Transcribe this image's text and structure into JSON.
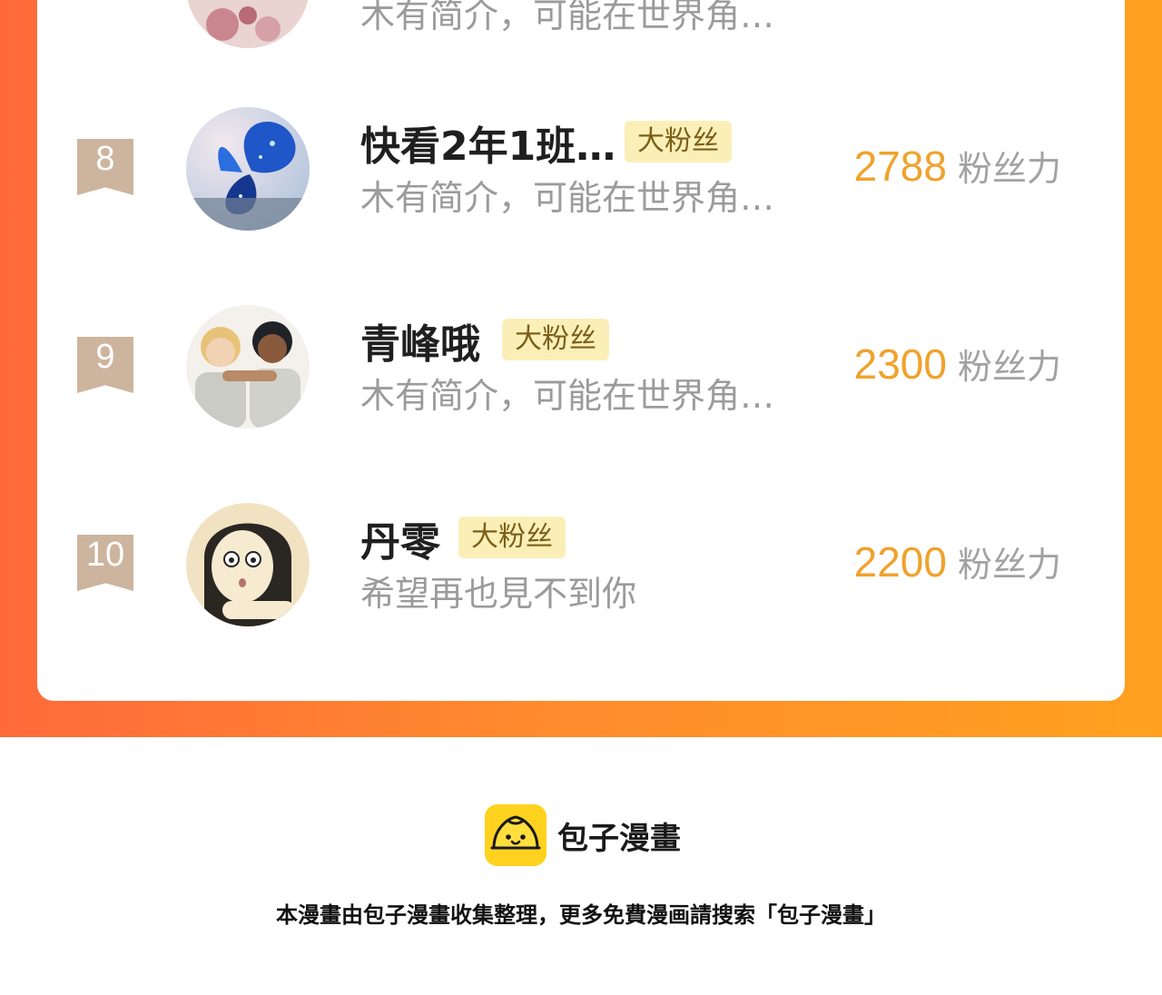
{
  "ranking": {
    "rows": [
      {
        "rank": "",
        "avatar": "flower-avatar",
        "name": "",
        "badge": "",
        "description": "木有简介，可能在世界角…",
        "score": "",
        "unit": ""
      },
      {
        "rank": "8",
        "avatar": "butterfly-avatar",
        "name": "快看2年1班…",
        "badge": "大粉丝",
        "description": "木有简介，可能在世界角…",
        "score": "2788",
        "unit": "粉丝力"
      },
      {
        "rank": "9",
        "avatar": "two-boys-avatar",
        "name": "青峰哦",
        "badge": "大粉丝",
        "description": "木有简介，可能在世界角…",
        "score": "2300",
        "unit": "粉丝力"
      },
      {
        "rank": "10",
        "avatar": "girl-sketch-avatar",
        "name": "丹零",
        "badge": "大粉丝",
        "description": "希望再也見不到你",
        "score": "2200",
        "unit": "粉丝力"
      }
    ]
  },
  "footer": {
    "logo_icon": "bun-logo-icon",
    "brand": "包子漫畫",
    "note": "本漫畫由包子漫畫收集整理，更多免費漫画請搜索「包子漫畫」"
  },
  "colors": {
    "banner_start": "#ff6a3a",
    "banner_end": "#ffa11f",
    "score": "#f0a22c",
    "badge_bg": "#fbefb8",
    "rank_ribbon": "#cdb49e",
    "logo_yellow": "#ffd21f"
  }
}
